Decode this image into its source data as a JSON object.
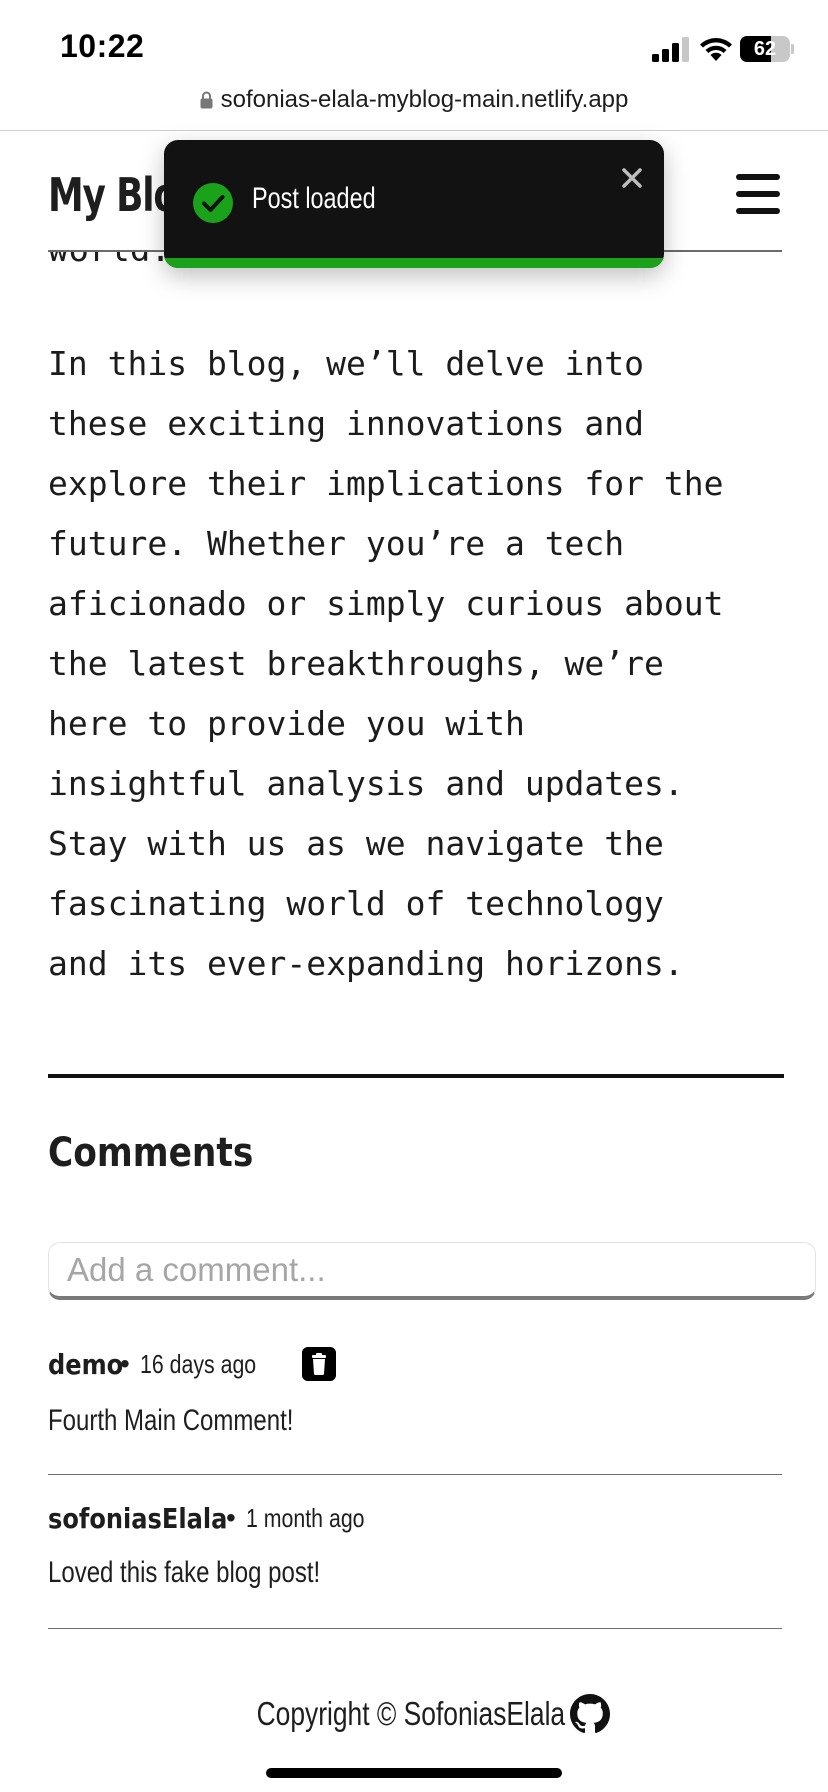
{
  "status_bar": {
    "time": "10:22",
    "battery": "62",
    "battery_level": 0.62,
    "icons": [
      "signal-icon",
      "wifi-icon",
      "battery-icon"
    ]
  },
  "browser": {
    "url": "sofonias-elala-myblog-main.netlify.app",
    "icon": "lock-icon"
  },
  "header": {
    "title": "My Blog",
    "menu_icon": "hamburger-menu-icon"
  },
  "toast": {
    "message": "Post loaded",
    "icon": "check-circle-icon",
    "close_icon": "close-icon",
    "progress": 1.0,
    "colors": {
      "background": "#121212",
      "success": "#1aa31a"
    }
  },
  "article": {
    "cut_text": "world.",
    "paragraph": "In this blog, we’ll delve into\nthese exciting innovations and\nexplore their implications for the\nfuture. Whether you’re a tech\naficionado or simply curious about\nthe latest breakthroughs, we’re\nhere to provide you with\ninsightful analysis and updates.\nStay with us as we navigate the\nfascinating world of technology\nand its ever-expanding horizons."
  },
  "comments": {
    "heading": "Comments",
    "input_placeholder": "Add a comment...",
    "items": [
      {
        "author": "demo",
        "separator": "•",
        "time": "16 days ago",
        "text": "Fourth Main Comment!",
        "has_delete": true,
        "delete_icon": "trash-icon"
      },
      {
        "author": "sofoniasElala",
        "separator": "•",
        "time": "1 month ago",
        "text": "Loved this fake blog post!",
        "has_delete": false
      }
    ]
  },
  "footer": {
    "text": "Copyright © SofoniasElala",
    "icon": "github-icon"
  }
}
